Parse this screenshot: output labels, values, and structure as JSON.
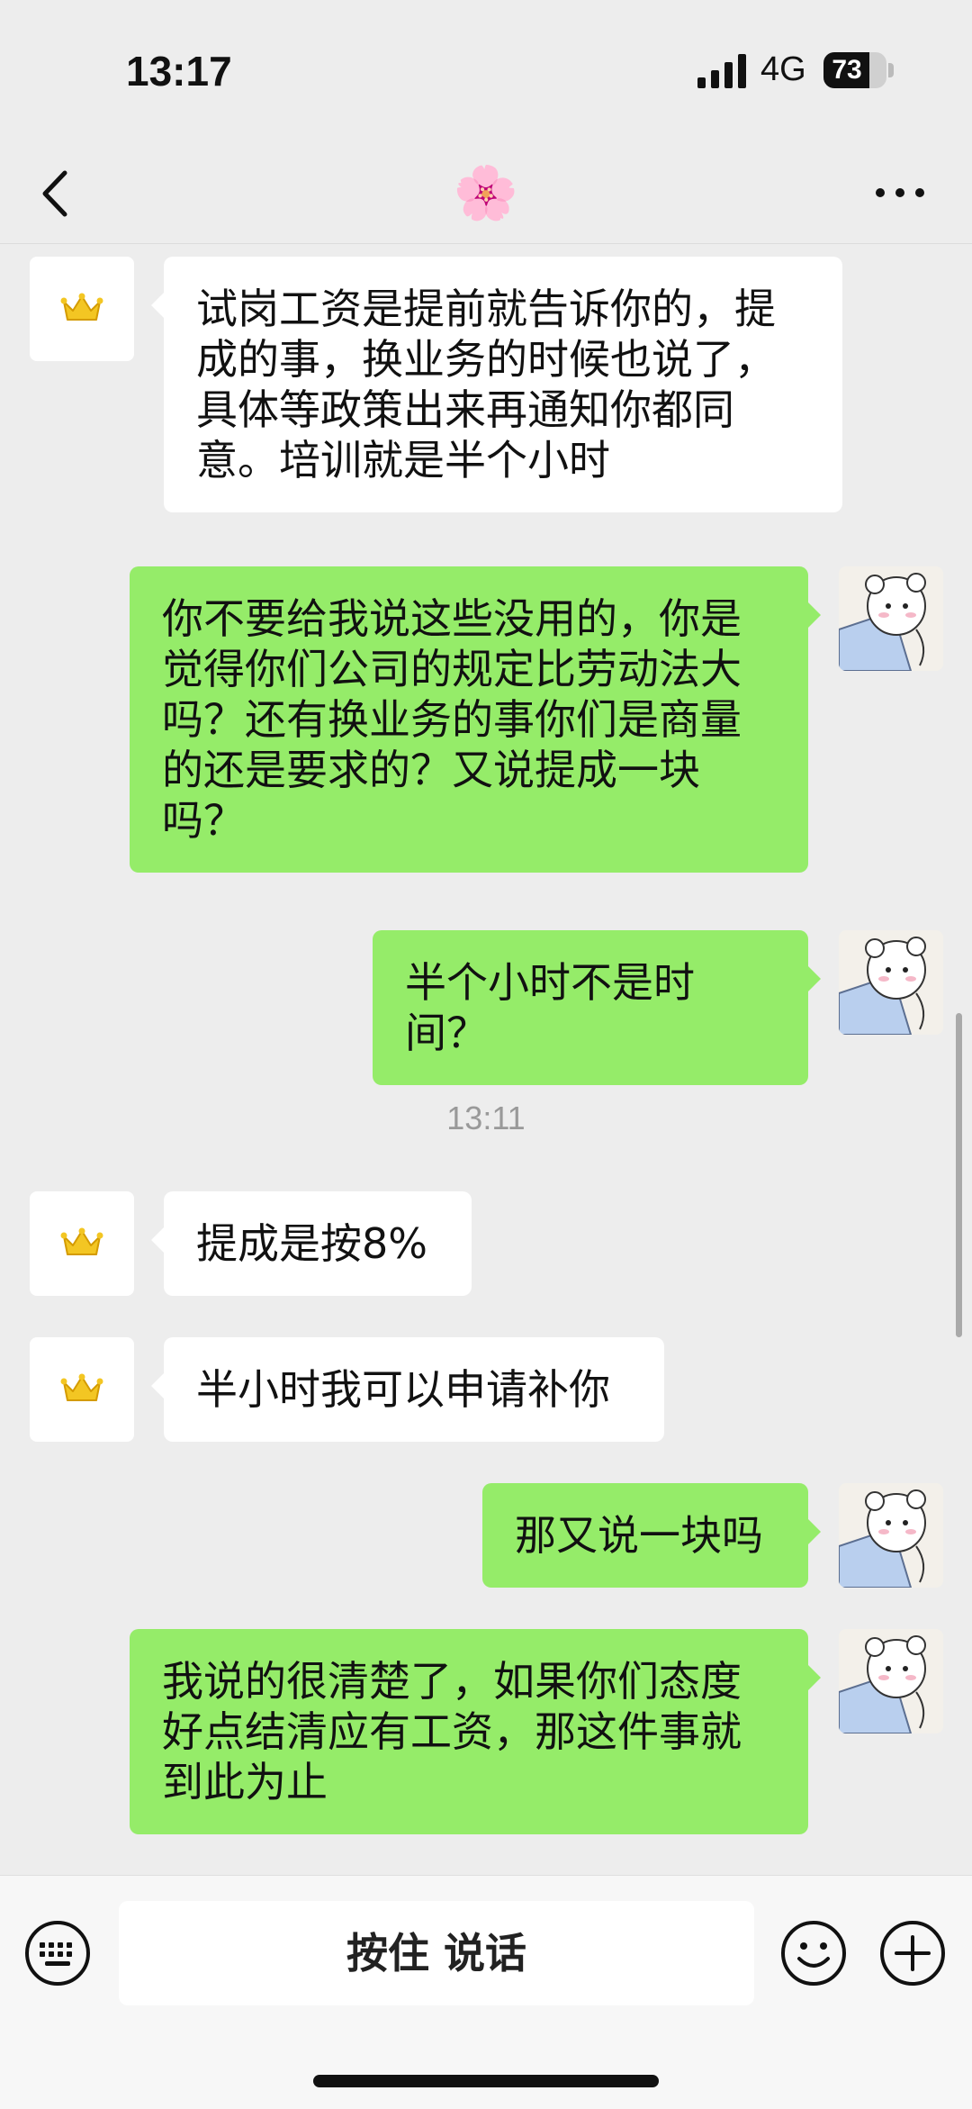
{
  "status_bar": {
    "time": "13:17",
    "network": "4G",
    "battery": "73",
    "battery_level": 0.73
  },
  "header": {
    "title": "🌸"
  },
  "messages": [
    {
      "side": "left",
      "text": "试岗工资是提前就告诉你的，提成的事，换业务的时候也说了，具体等政策出来再通知你都同意。培训就是半个小时"
    },
    {
      "side": "right",
      "text": "你不要给我说这些没用的，你是觉得你们公司的规定比劳动法大吗？还有换业务的事你们是商量的还是要求的？又说提成一块吗？"
    },
    {
      "side": "right",
      "text": "半个小时不是时间？"
    },
    {
      "type": "time",
      "text": "13:11"
    },
    {
      "side": "left",
      "text": "提成是按8%"
    },
    {
      "side": "left",
      "text": "半小时我可以申请补你"
    },
    {
      "side": "right",
      "text": "那又说一块吗"
    },
    {
      "side": "right",
      "text": "我说的很清楚了，如果你们态度好点结清应有工资，那这件事就到此为止"
    }
  ],
  "input_bar": {
    "voice_label": "按住 说话"
  },
  "icons": {
    "back": "chevron-left-icon",
    "more": "more-dots-icon",
    "keyboard": "keyboard-icon",
    "emoji": "smiley-icon",
    "plus": "plus-circle-icon",
    "left_avatar": "crown-icon",
    "right_avatar": "bear-icon"
  },
  "colors": {
    "background": "#ededed",
    "bubble_right": "#95ec69",
    "bubble_left": "#ffffff",
    "crown": "#f3c623"
  }
}
